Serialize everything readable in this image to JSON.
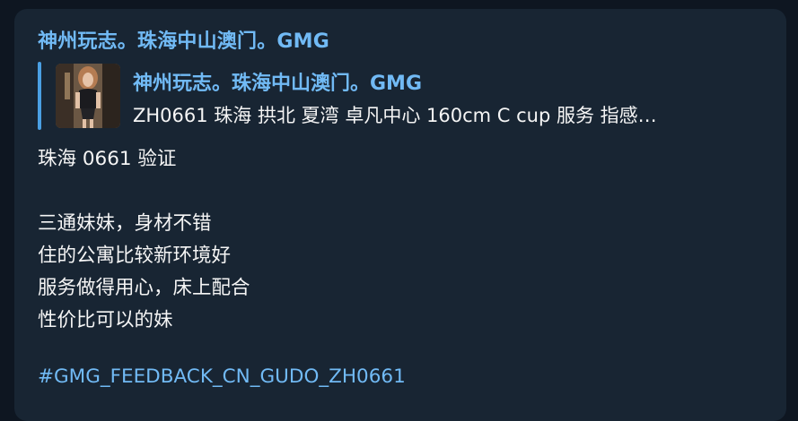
{
  "message": {
    "sender_name": "神州玩志。珠海中山澳门。GMG",
    "reply": {
      "title": "神州玩志。珠海中山澳门。GMG",
      "text": "ZH0661 珠海 拱北 夏湾 卓凡中心 160cm  C cup  服务 指感…",
      "thumbnail_icon": "photo-thumbnail"
    },
    "body_lines": [
      "珠海 0661 验证",
      "",
      "三通妹妹，身材不错",
      "住的公寓比较新环境好",
      "服务做得用心，床上配合",
      "性价比可以的妹",
      ""
    ],
    "hashtag": "#GMG_FEEDBACK_CN_GUDO_ZH0661"
  },
  "colors": {
    "background": "#0e1621",
    "bubble": "#182533",
    "accent": "#71baf5",
    "reply_bar": "#4a9fe3",
    "text": "#f5f5f5"
  }
}
